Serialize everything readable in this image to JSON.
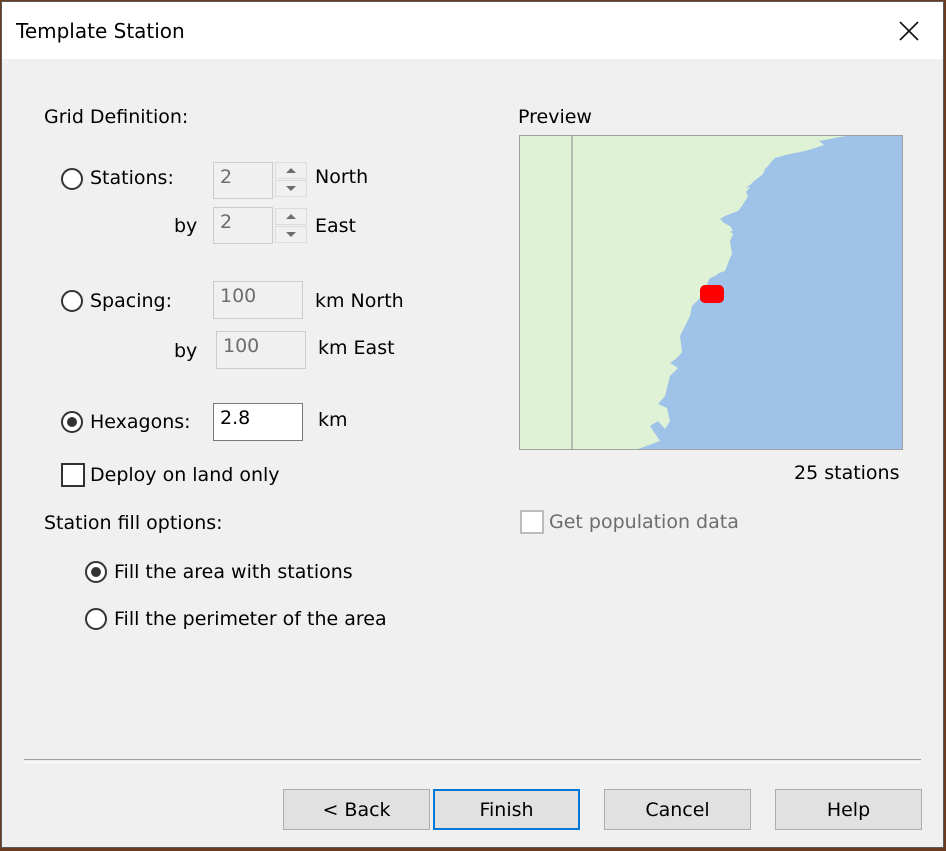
{
  "window": {
    "title": "Template Station",
    "close_icon": "close-icon"
  },
  "grid_definition": {
    "heading": "Grid Definition:",
    "stations": {
      "label": "Stations:",
      "selected": false,
      "north_value": "2",
      "north_unit": "North",
      "by_label": "by",
      "east_value": "2",
      "east_unit": "East"
    },
    "spacing": {
      "label": "Spacing:",
      "selected": false,
      "north_value": "100",
      "north_unit": "km North",
      "by_label": "by",
      "east_value": "100",
      "east_unit": "km East"
    },
    "hexagons": {
      "label": "Hexagons:",
      "selected": true,
      "value": "2.8",
      "unit": "km"
    },
    "deploy_land_only": {
      "label": "Deploy on land only",
      "checked": false
    }
  },
  "station_fill": {
    "heading": "Station fill options:",
    "options": [
      {
        "label": "Fill the area with stations",
        "selected": true
      },
      {
        "label": "Fill the perimeter of the area",
        "selected": false
      }
    ]
  },
  "preview": {
    "label": "Preview",
    "station_count_text": "25 stations",
    "colors": {
      "land": "#dff2d6",
      "water": "#9fc2e8",
      "stations": "#ff0000",
      "boundary": "#8a8a8a"
    }
  },
  "population": {
    "label": "Get population data",
    "checked": false,
    "enabled": false
  },
  "buttons": {
    "back": "< Back",
    "finish": "Finish",
    "cancel": "Cancel",
    "help": "Help"
  }
}
